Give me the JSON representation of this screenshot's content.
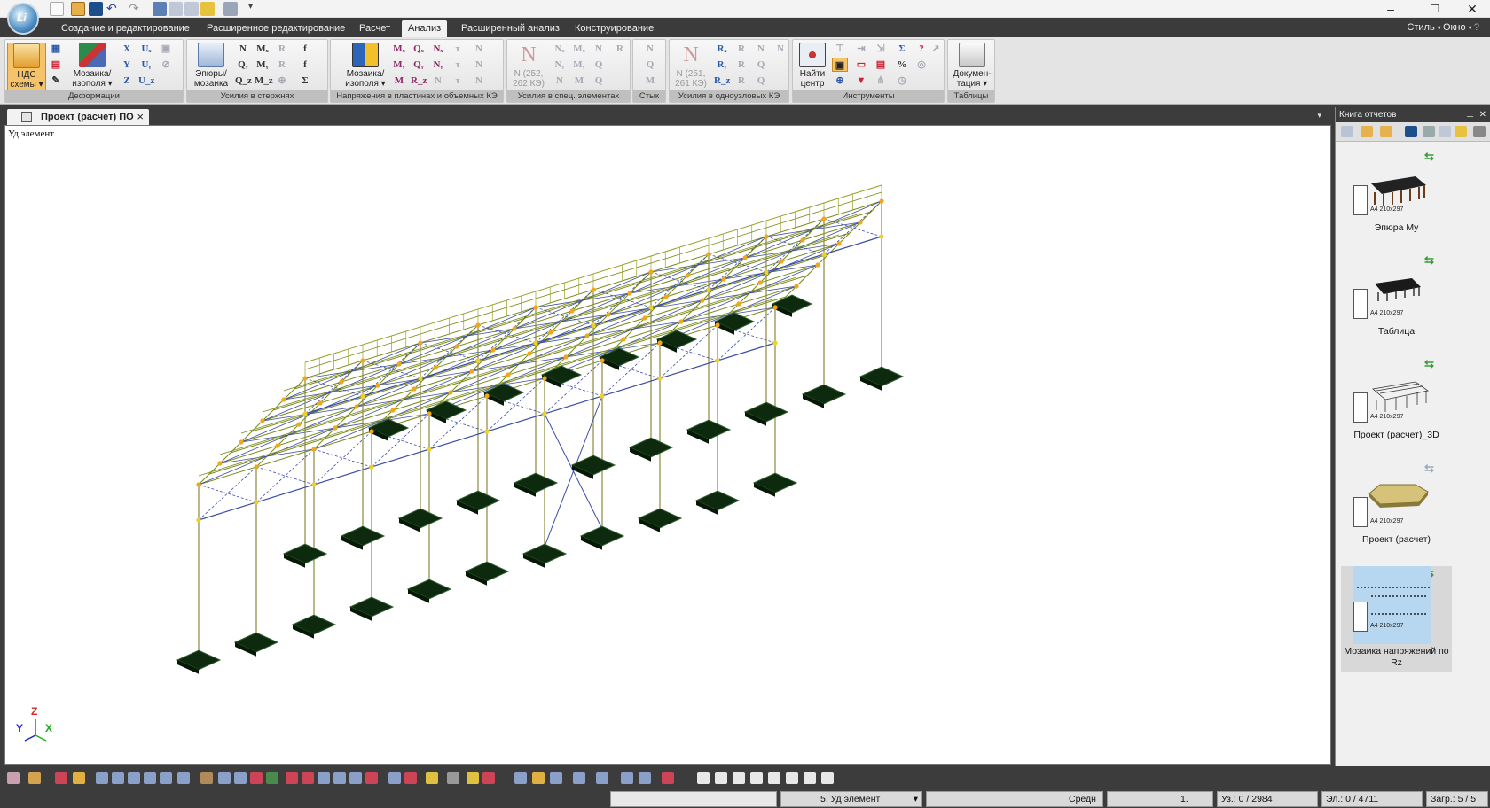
{
  "window": {
    "minimize": "–",
    "restore": "❐",
    "close": "✕"
  },
  "menu": {
    "tabs": [
      {
        "label": "Создание и редактирование"
      },
      {
        "label": "Расширенное редактирование"
      },
      {
        "label": "Расчет"
      },
      {
        "label": "Анализ"
      },
      {
        "label": "Расширенный анализ"
      },
      {
        "label": "Конструирование"
      }
    ],
    "style_label": "Стиль",
    "window_label": "Окно"
  },
  "ribbon": {
    "groups": {
      "deformations": "Деформации",
      "rod_forces": "Усилия в стержнях",
      "plate_stresses": "Напряжения в пластинах и объемных КЭ",
      "special_forces": "Усилия в спец. элементах",
      "joint": "Стык",
      "single_node_forces": "Усилия в одноузловых КЭ",
      "tools": "Инструменты",
      "tables": "Таблицы"
    },
    "buttons": {
      "nds_line1": "НДС",
      "nds_line2": "схемы",
      "mosaic1_line1": "Мозаика/",
      "mosaic1_line2": "изополя",
      "epure_line1": "Эпюры/",
      "epure_line2": "мозаика",
      "mosaic2_line1": "Мозаика/",
      "mosaic2_line2": "изополя",
      "n_special_1": "N (252,",
      "n_special_2": "262 КЭ)",
      "n_single_1": "N (251,",
      "n_single_2": "261 КЭ)",
      "find_center_1": "Найти",
      "find_center_2": "центр",
      "docs_1": "Докумен-",
      "docs_2": "тация"
    }
  },
  "document": {
    "tab_label": "Проект (расчет)  ПО",
    "viewport_label": "Уд элемент",
    "axis_x": "X",
    "axis_y": "Y",
    "axis_z": "Z"
  },
  "report_book": {
    "title": "Книга отчетов",
    "items": [
      {
        "name": "Эпюра My",
        "format": "A4 210x297"
      },
      {
        "name": "Таблица",
        "format": "A4 210x297"
      },
      {
        "name": "Проект (расчет)_3D",
        "format": "A4 210x297"
      },
      {
        "name": "Проект (расчет)",
        "format": "A4 210x297"
      },
      {
        "name": "Мозаика напряжений по Rz",
        "format": "A4 210x297"
      }
    ]
  },
  "status": {
    "element_mode": "5. Уд элемент",
    "averaging": "Средн",
    "scale_value": "1.",
    "nodes": "Уз.: 0 / 2984",
    "elements": "Эл.: 0 / 4711",
    "loads": "Загр.: 5 / 5"
  },
  "colors": {
    "frame_dark": "#3c3c3c",
    "ribbon_bg": "#e4e4e4",
    "highlight": "#f5c46a",
    "structure_green": "#7a8a16",
    "structure_blue": "#3a4ca8",
    "footing": "#0e2a0e",
    "node": "#f2a71b"
  }
}
